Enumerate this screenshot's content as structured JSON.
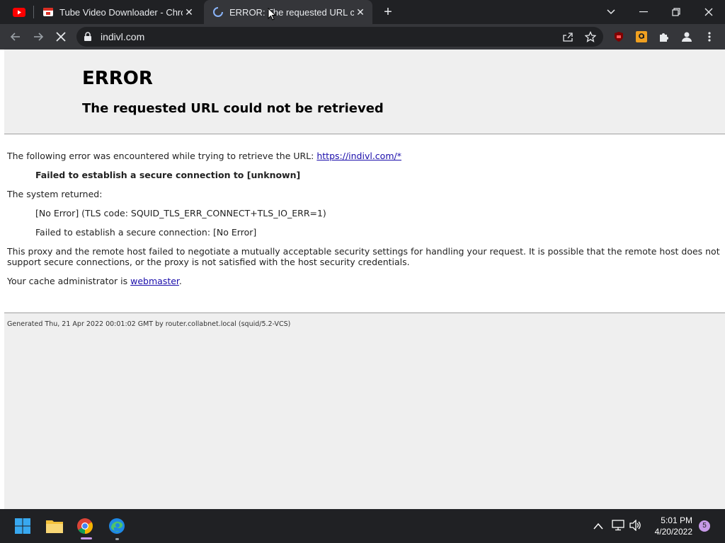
{
  "browser": {
    "tabs": [
      {
        "title": "Tube Video Downloader - Chrome"
      },
      {
        "title": "ERROR: The requested URL could not be retrieved"
      }
    ],
    "url": "indivl.com"
  },
  "page": {
    "heading": "ERROR",
    "subheading": "The requested URL could not be retrieved",
    "intro_text": "The following error was encountered while trying to retrieve the URL:",
    "intro_link": "https://indivl.com/*",
    "failure_line": "Failed to establish a secure connection to [unknown]",
    "system_returned_label": "The system returned:",
    "system_line1": "[No Error] (TLS code: SQUID_TLS_ERR_CONNECT+TLS_IO_ERR=1)",
    "system_line2": "Failed to establish a secure connection: [No Error]",
    "explanation_line1": "This proxy and the remote host failed to negotiate a mutually acceptable security settings for handling your request. It is possible that the remote host does not",
    "explanation_line2": "support secure connections, or the proxy is not satisfied with the host security credentials.",
    "admin_text": "Your cache administrator is",
    "admin_link": "webmaster",
    "admin_suffix": ".",
    "footer": "Generated Thu, 21 Apr 2022 00:01:02 GMT by router.collabnet.local (squid/5.2-VCS)"
  },
  "taskbar": {
    "time": "5:01 PM",
    "date": "4/20/2022",
    "notification_count": "5"
  },
  "colors": {
    "accent_link": "#1a0dab",
    "page_bg": "#efefef",
    "chrome_dark": "#202124"
  }
}
